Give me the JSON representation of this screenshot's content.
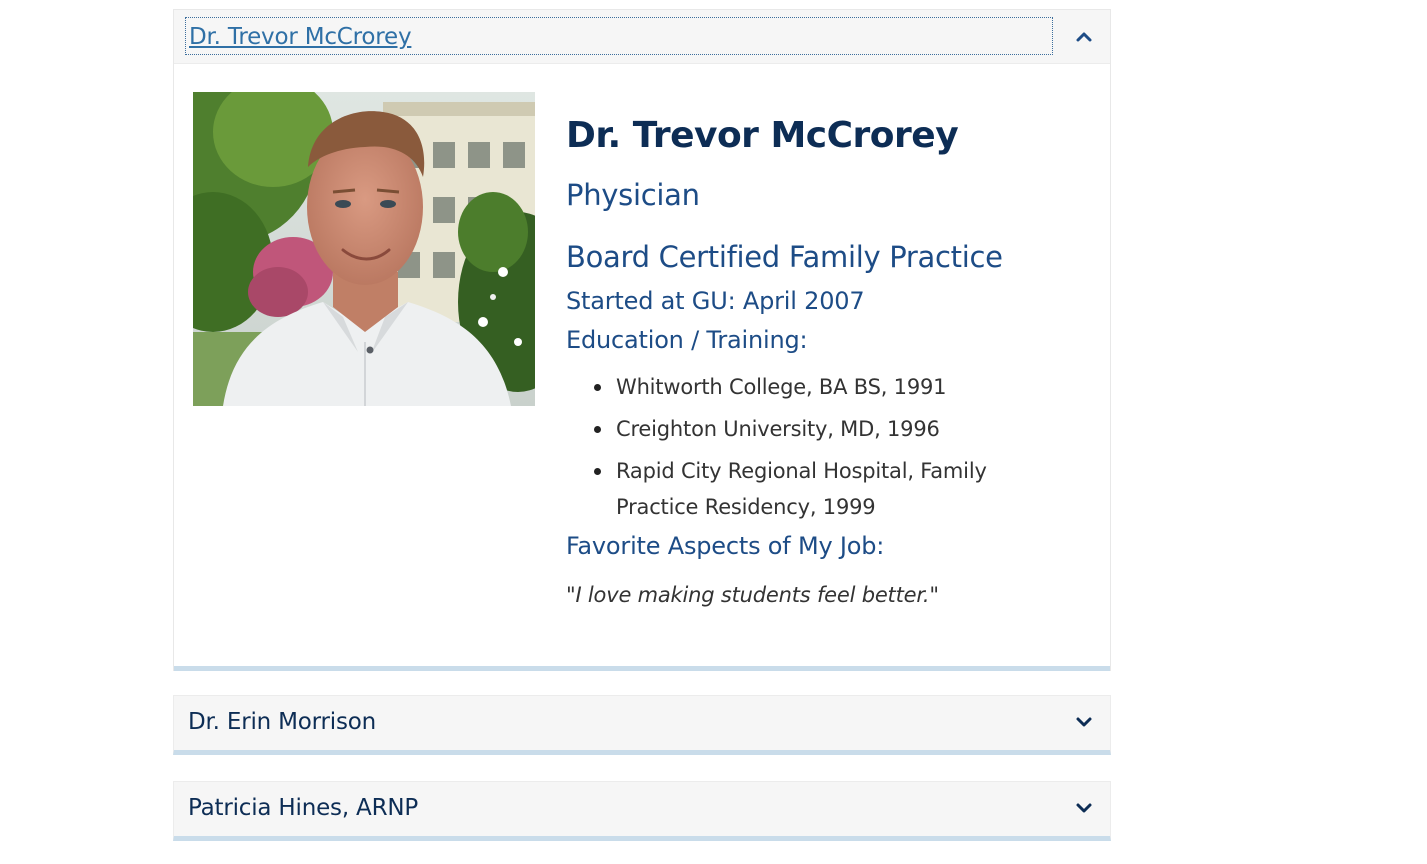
{
  "accordion": {
    "items": [
      {
        "title": "Dr. Trevor McCrorey",
        "expanded": true,
        "toggle_icon": "chevron-up-icon",
        "profile": {
          "photo_icon": "portrait-photo",
          "name": "Dr. Trevor McCrorey",
          "role": "Physician",
          "certification": "Board Certified Family Practice",
          "started": "Started at GU: April 2007",
          "education_label": "Education / Training:",
          "education": [
            "Whitworth College, BA BS, 1991",
            "Creighton University, MD, 1996",
            "Rapid City Regional Hospital, Family Practice Residency, 1999"
          ],
          "favorite_label": "Favorite Aspects of My Job:",
          "quote": "\"I love making students feel better.\""
        }
      },
      {
        "title": "Dr. Erin Morrison",
        "expanded": false,
        "toggle_icon": "chevron-down-icon"
      },
      {
        "title": "Patricia Hines, ARNP",
        "expanded": false,
        "toggle_icon": "chevron-down-icon"
      }
    ]
  },
  "colors": {
    "heading_navy": "#0d2d55",
    "accent_blue": "#1d4c86",
    "link_blue": "#2f70a6",
    "panel_border_blue": "#c9dcea",
    "header_bg": "#f6f6f6"
  }
}
